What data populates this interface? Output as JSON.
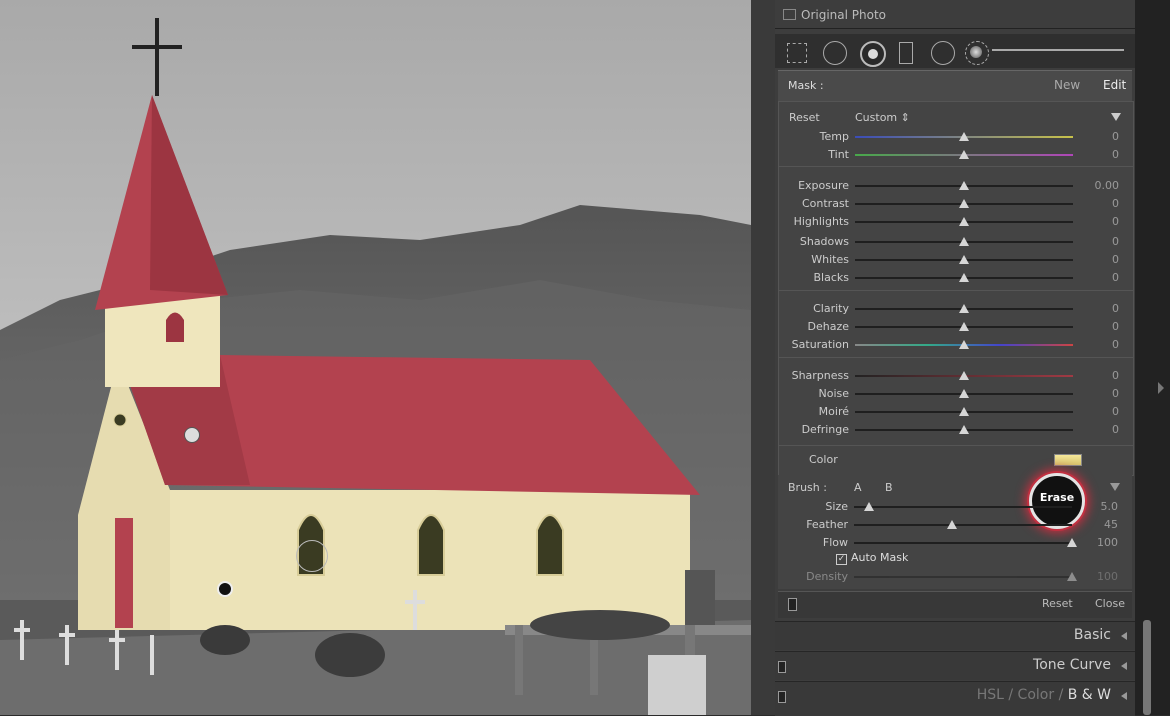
{
  "photo": {
    "alt": "church"
  },
  "panel": {
    "original_photo": "Original Photo",
    "mask_label": "Mask :",
    "mask_new": "New",
    "mask_edit": "Edit",
    "reset_label": "Reset",
    "preset": "Custom",
    "color_label": "Color",
    "sliders": [
      {
        "name": "Temp",
        "value": "0",
        "pos": 0.5
      },
      {
        "name": "Tint",
        "value": "0",
        "pos": 0.5
      },
      {
        "name": "Exposure",
        "value": "0.00",
        "pos": 0.5
      },
      {
        "name": "Contrast",
        "value": "0",
        "pos": 0.5
      },
      {
        "name": "Highlights",
        "value": "0",
        "pos": 0.5
      },
      {
        "name": "Shadows",
        "value": "0",
        "pos": 0.5
      },
      {
        "name": "Whites",
        "value": "0",
        "pos": 0.5
      },
      {
        "name": "Blacks",
        "value": "0",
        "pos": 0.5
      },
      {
        "name": "Clarity",
        "value": "0",
        "pos": 0.5
      },
      {
        "name": "Dehaze",
        "value": "0",
        "pos": 0.5
      },
      {
        "name": "Saturation",
        "value": "0",
        "pos": 0.5
      },
      {
        "name": "Sharpness",
        "value": "0",
        "pos": 0.5
      },
      {
        "name": "Noise",
        "value": "0",
        "pos": 0.5
      },
      {
        "name": "Moiré",
        "value": "0",
        "pos": 0.5
      },
      {
        "name": "Defringe",
        "value": "0",
        "pos": 0.5
      }
    ],
    "brush": {
      "label": "Brush :",
      "a": "A",
      "b": "B",
      "erase": "Erase",
      "sliders": [
        {
          "name": "Size",
          "value": "5.0",
          "pos": 0.07
        },
        {
          "name": "Feather",
          "value": "45",
          "pos": 0.45
        },
        {
          "name": "Flow",
          "value": "100",
          "pos": 1.0
        }
      ],
      "auto_mask": "Auto Mask",
      "density_label": "Density",
      "density_value": "100",
      "density_pos": 1.0
    },
    "reset_button": "Reset",
    "close_button": "Close",
    "sections": {
      "basic": "Basic",
      "tone_curve": "Tone Curve",
      "hsl": "HSL",
      "color": "Color",
      "bw": "B & W",
      "slash": "/"
    }
  }
}
